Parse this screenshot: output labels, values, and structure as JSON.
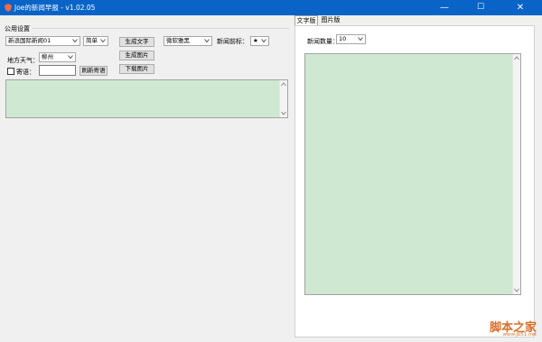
{
  "window": {
    "title": "Joe的新闻早报 - v1.02.05",
    "minimize_glyph": "—",
    "maximize_glyph": "☐",
    "close_glyph": "✕"
  },
  "left": {
    "group_label": "公用设置",
    "news_source": "新浪国际新闻01",
    "simplicity": "简单",
    "generate_text_button": "生成文字",
    "font": "微软雅黑",
    "prefix_label": "新闻前标：",
    "prefix_value": "★",
    "generate_image_button": "生成图片",
    "weather_label": "地方天气：",
    "city": "柳州",
    "download_image_button": "下载图片",
    "motto_label": "寄语：",
    "motto_value": "",
    "refresh_motto_button": "刷新寄语",
    "motto_checked": false
  },
  "right": {
    "tabs": [
      {
        "label": "文字版"
      },
      {
        "label": "图片版"
      }
    ],
    "count_label": "新闻数量：",
    "count_value": "10"
  },
  "watermark": {
    "text": "脚本之家",
    "url": "www.jb51.net"
  },
  "colors": {
    "titlebar": "#0a64c8",
    "text_area_bg": "#cfe8d1",
    "watermark": "#d96f29"
  }
}
